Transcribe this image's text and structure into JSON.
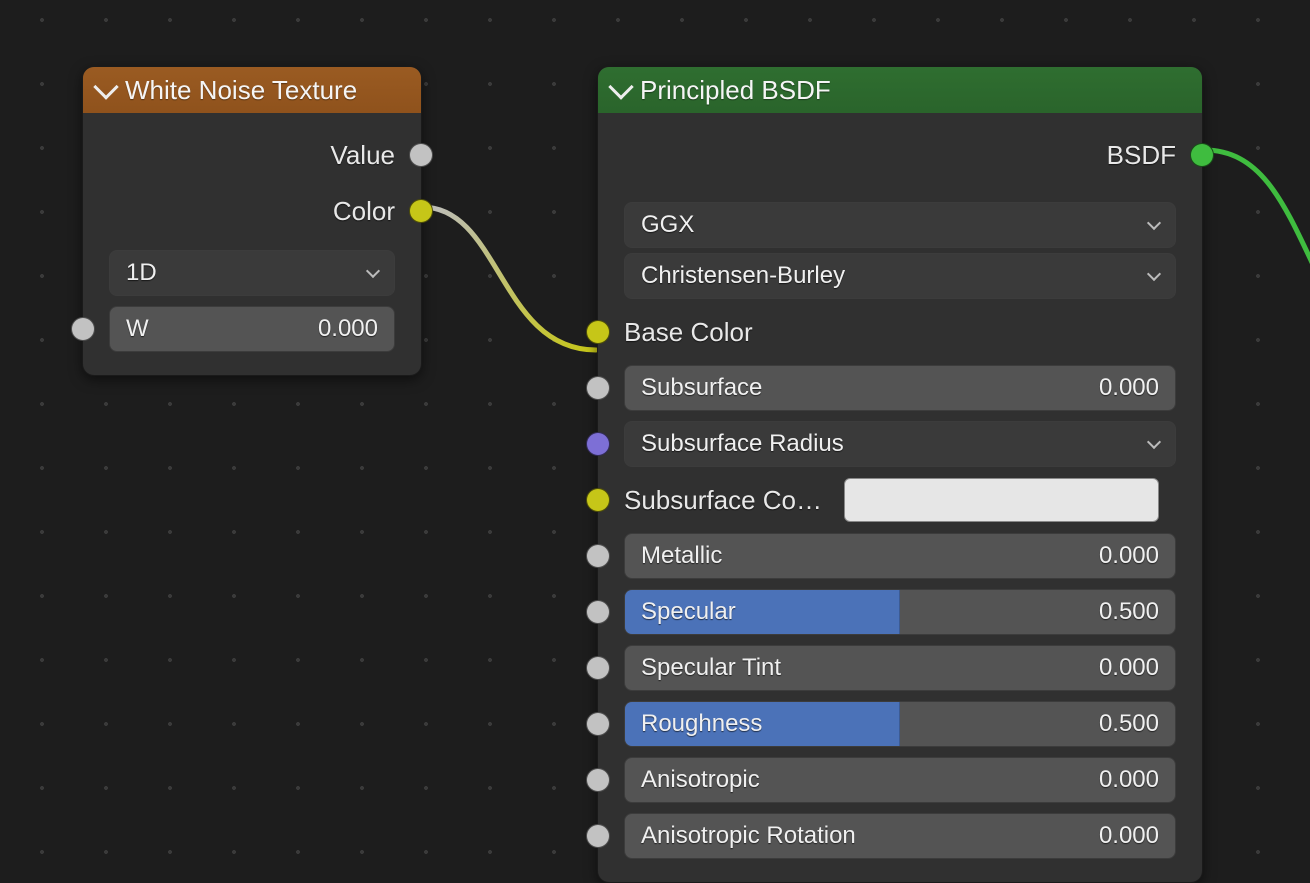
{
  "node_editor": {
    "wires": [
      {
        "from": "white_noise.color",
        "to": "bsdf.base_color",
        "color": "#c6c618"
      },
      {
        "from": "bsdf.bsdf",
        "to": "offscreen",
        "color": "#3fbc3f"
      }
    ]
  },
  "white_noise": {
    "title": "White Noise Texture",
    "outputs": {
      "value": "Value",
      "color": "Color"
    },
    "dimensions": {
      "selected": "1D"
    },
    "inputs": {
      "w": {
        "label": "W",
        "value": "0.000"
      }
    }
  },
  "bsdf": {
    "title": "Principled BSDF",
    "outputs": {
      "bsdf": "BSDF"
    },
    "distribution": {
      "selected": "GGX"
    },
    "sss_method": {
      "selected": "Christensen-Burley"
    },
    "inputs": {
      "base_color": {
        "label": "Base Color"
      },
      "subsurface": {
        "label": "Subsurface",
        "value": "0.000",
        "fill": 0
      },
      "subsurface_radius": {
        "label": "Subsurface Radius"
      },
      "subsurface_color": {
        "label": "Subsurface Co…",
        "swatch": "#e6e6e6"
      },
      "metallic": {
        "label": "Metallic",
        "value": "0.000",
        "fill": 0
      },
      "specular": {
        "label": "Specular",
        "value": "0.500",
        "fill": 0.5
      },
      "specular_tint": {
        "label": "Specular Tint",
        "value": "0.000",
        "fill": 0
      },
      "roughness": {
        "label": "Roughness",
        "value": "0.500",
        "fill": 0.5
      },
      "anisotropic": {
        "label": "Anisotropic",
        "value": "0.000",
        "fill": 0
      },
      "anisotropic_rotation": {
        "label": "Anisotropic Rotation",
        "value": "0.000",
        "fill": 0
      }
    }
  }
}
